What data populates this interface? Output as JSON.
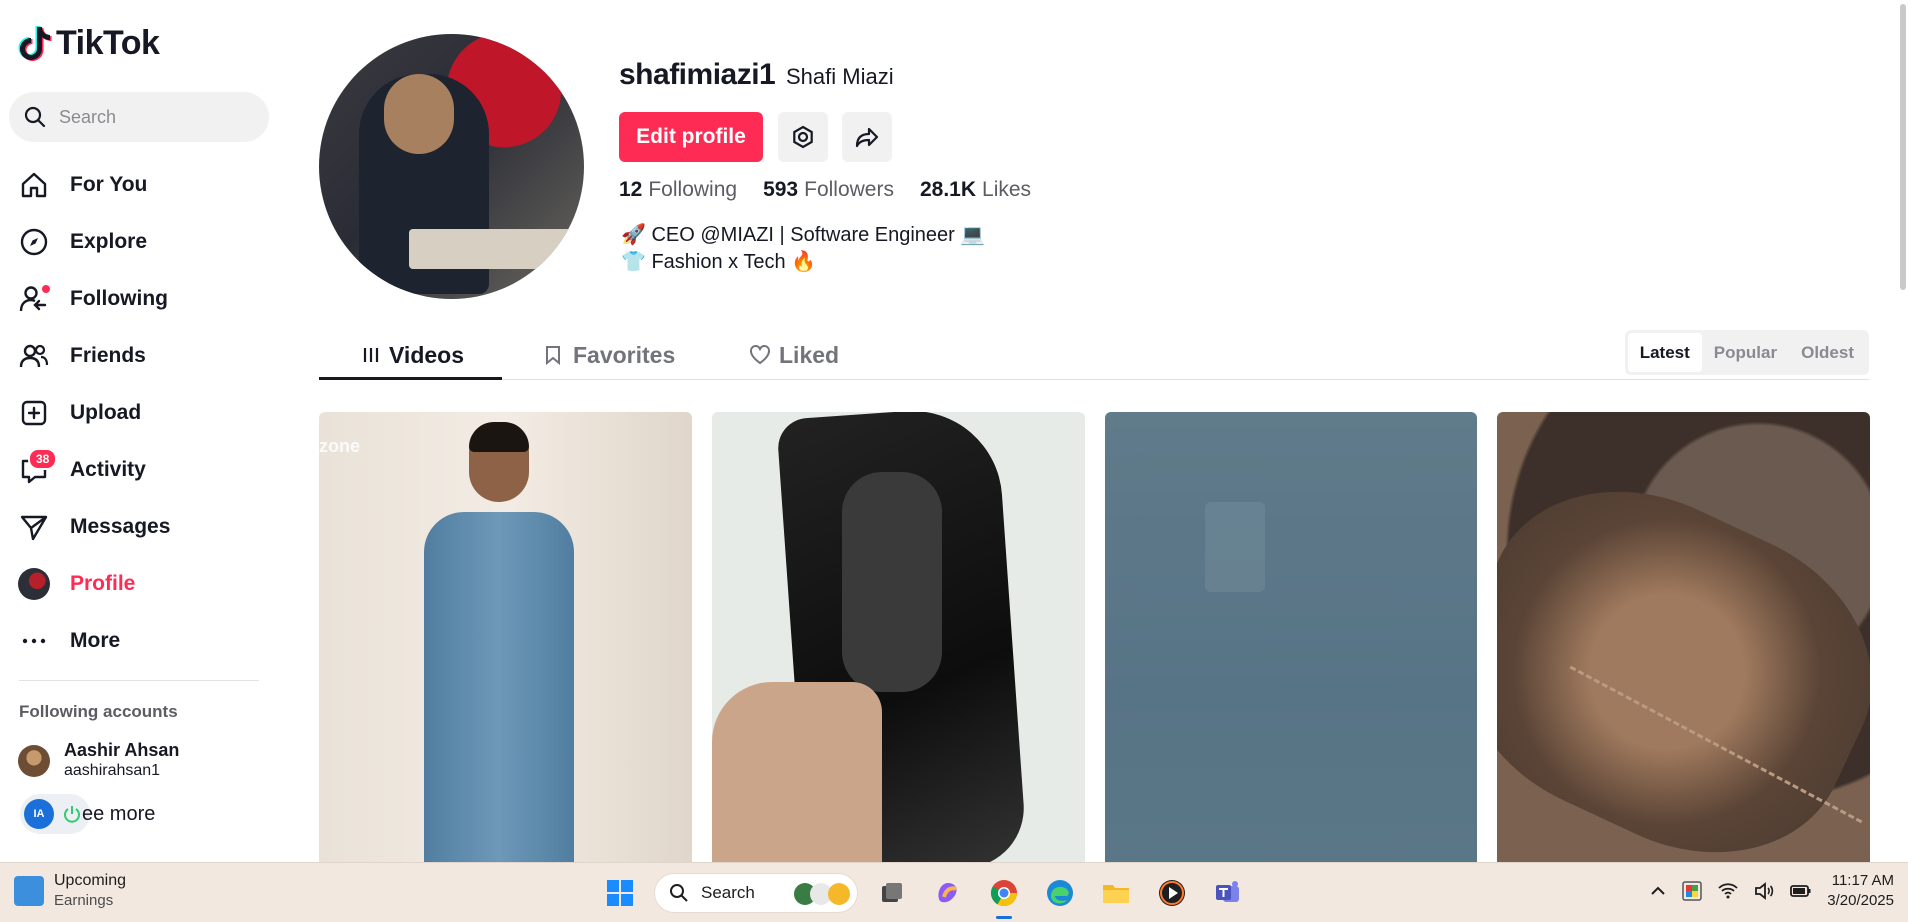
{
  "app": {
    "name": "TikTok"
  },
  "search": {
    "placeholder": "Search"
  },
  "nav": {
    "items": [
      {
        "label": "For You",
        "icon": "home-icon"
      },
      {
        "label": "Explore",
        "icon": "compass-icon"
      },
      {
        "label": "Following",
        "icon": "following-icon"
      },
      {
        "label": "Friends",
        "icon": "friends-icon"
      },
      {
        "label": "Upload",
        "icon": "upload-icon"
      },
      {
        "label": "Activity",
        "icon": "inbox-icon",
        "badge": "38"
      },
      {
        "label": "Messages",
        "icon": "send-icon"
      },
      {
        "label": "Profile",
        "icon": "avatar"
      },
      {
        "label": "More",
        "icon": "more-icon"
      }
    ]
  },
  "following_accounts": {
    "title": "Following accounts",
    "items": [
      {
        "name": "Aashir Ahsan",
        "username": "aashirahsan1"
      }
    ],
    "see_more": "ee more"
  },
  "profile": {
    "username": "shafimiazi1",
    "nickname": "Shafi Miazi",
    "edit_label": "Edit profile",
    "stats": {
      "following": {
        "value": "12",
        "label": "Following"
      },
      "followers": {
        "value": "593",
        "label": "Followers"
      },
      "likes": {
        "value": "28.1K",
        "label": "Likes"
      }
    },
    "bio": {
      "line1": "🚀 CEO @MIAZI | Software Engineer 💻",
      "line2": "👕 Fashion x Tech 🔥"
    }
  },
  "tabs": {
    "items": [
      {
        "label": "Videos"
      },
      {
        "label": "Favorites"
      },
      {
        "label": "Liked"
      }
    ],
    "active": "Videos"
  },
  "sort": {
    "options": [
      "Latest",
      "Popular",
      "Oldest"
    ],
    "active": "Latest"
  },
  "videos": {
    "v1_watermark": "zone"
  },
  "taskbar": {
    "widget_title": "Upcoming",
    "widget_sub": "Earnings",
    "search_label": "Search",
    "time": "11:17 AM",
    "date": "3/20/2025"
  },
  "colors": {
    "accent": "#fe2c55",
    "text": "#161823",
    "muted": "#73747b"
  }
}
